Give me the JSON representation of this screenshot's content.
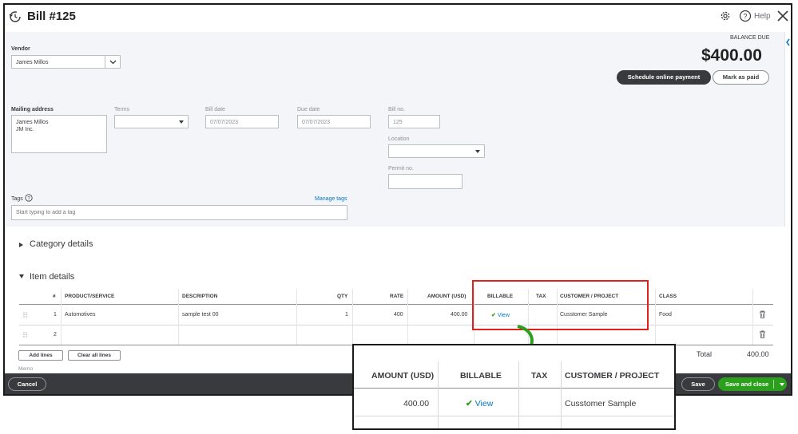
{
  "title": "Bill #125",
  "header_icons": {
    "gear": "gear-icon",
    "help": "help-icon",
    "close": "close-icon"
  },
  "help_label": "Help",
  "vendor": {
    "label": "Vendor",
    "value": "James Millos"
  },
  "balance": {
    "label": "BALANCE DUE",
    "value": "$400.00"
  },
  "buttons": {
    "schedule_payment": "Schedule online payment",
    "mark_paid": "Mark as paid"
  },
  "mailing_address": {
    "label": "Mailing address",
    "value": "James Millos\nJM Inc."
  },
  "terms": {
    "label": "Terms",
    "value": ""
  },
  "bill_date": {
    "label": "Bill date",
    "value": "07/07/2023"
  },
  "due_date": {
    "label": "Due date",
    "value": "07/07/2023"
  },
  "bill_no": {
    "label": "Bill no.",
    "value": "125"
  },
  "location": {
    "label": "Location",
    "value": ""
  },
  "permit_no": {
    "label": "Permit no.",
    "value": ""
  },
  "tags": {
    "label": "Tags",
    "manage": "Manage tags",
    "placeholder": "Start typing to add a tag"
  },
  "sections": {
    "category": "Category details",
    "item": "Item details"
  },
  "item_table": {
    "headers": {
      "num": "#",
      "product": "PRODUCT/SERVICE",
      "description": "DESCRIPTION",
      "qty": "QTY",
      "rate": "RATE",
      "amount": "AMOUNT (USD)",
      "billable": "BILLABLE",
      "tax": "TAX",
      "customer": "CUSTOMER / PROJECT",
      "class": "CLASS"
    },
    "rows": [
      {
        "num": "1",
        "product": "Automotives",
        "description": "sample test 00",
        "qty": "1",
        "rate": "400",
        "amount": "400.00",
        "billable": "View",
        "tax": "",
        "customer": "Cusstomer Sample",
        "class": "Food"
      },
      {
        "num": "2",
        "product": "",
        "description": "",
        "qty": "",
        "rate": "",
        "amount": "",
        "billable": "",
        "tax": "",
        "customer": "",
        "class": ""
      }
    ]
  },
  "table_buttons": {
    "add_lines": "Add lines",
    "clear_lines": "Clear all lines"
  },
  "total": {
    "label": "Total",
    "value": "400.00"
  },
  "memo_label": "Memo",
  "footer": {
    "cancel": "Cancel",
    "save": "Save",
    "save_close": "Save and close"
  },
  "zoom": {
    "headers": {
      "amount": "AMOUNT (USD)",
      "billable": "BILLABLE",
      "tax": "TAX",
      "customer": "CUSTOMER / PROJECT"
    },
    "row": {
      "amount": "400.00",
      "billable": "View",
      "customer": "Cusstomer Sample"
    }
  },
  "colors": {
    "accent_green": "#2ca01c",
    "link_blue": "#0077c5",
    "highlight_red": "#e0201b",
    "dark": "#393a3d"
  }
}
